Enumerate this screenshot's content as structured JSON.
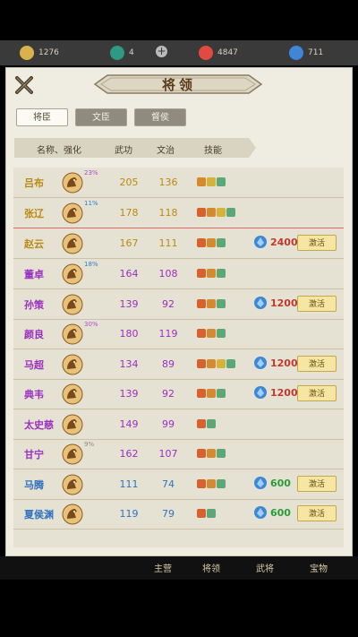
{
  "resources": [
    {
      "icon": "gold-coin-icon",
      "value": "1276",
      "color": "#d9b14d"
    },
    {
      "icon": "jade-icon",
      "value": "4",
      "color": "#2f9a84"
    },
    {
      "icon": "red-crystal-icon",
      "value": "4847",
      "color": "#e04a40"
    },
    {
      "icon": "blue-crystal-icon",
      "value": "711",
      "color": "#3f86d6"
    }
  ],
  "title": "将领",
  "tabs": [
    {
      "label": "将臣",
      "active": true
    },
    {
      "label": "文臣",
      "active": false
    },
    {
      "label": "督侯",
      "active": false
    }
  ],
  "headers": {
    "name": "名称、强化",
    "wugong": "武功",
    "wenzhi": "文治",
    "skills": "技能"
  },
  "rows": [
    {
      "name": "吕布",
      "name_color": "#b88a12",
      "pct": "23%",
      "pct_color": "#b04ad0",
      "wugong": "205",
      "wenzhi": "136",
      "stat_color": "#b88a12",
      "skills": [
        "#d68a2f",
        "#d6b23c",
        "#5aa878"
      ]
    },
    {
      "name": "张辽",
      "name_color": "#b88a12",
      "pct": "11%",
      "pct_color": "#2f80c8",
      "wugong": "178",
      "wenzhi": "118",
      "stat_color": "#b88a12",
      "skills": [
        "#d6622f",
        "#d68a2f",
        "#d6b23c",
        "#5aa878"
      ]
    },
    {
      "name": "赵云",
      "name_color": "#b88a12",
      "pct": "",
      "pct_color": "#b04ad0",
      "wugong": "167",
      "wenzhi": "111",
      "stat_color": "#b88a12",
      "skills": [
        "#d6622f",
        "#d68a2f",
        "#5aa878"
      ],
      "cost": "2400",
      "button": "激活"
    },
    {
      "name": "董卓",
      "name_color": "#9a2fc0",
      "pct": "18%",
      "pct_color": "#2f80c8",
      "wugong": "164",
      "wenzhi": "108",
      "stat_color": "#9a2fc0",
      "skills": [
        "#d6622f",
        "#d68a2f",
        "#5aa878"
      ]
    },
    {
      "name": "孙策",
      "name_color": "#9a2fc0",
      "pct": "",
      "pct_color": "#b04ad0",
      "wugong": "139",
      "wenzhi": "92",
      "stat_color": "#9a2fc0",
      "skills": [
        "#d6622f",
        "#d68a2f",
        "#5aa878"
      ],
      "cost": "1200",
      "button": "激活"
    },
    {
      "name": "颜良",
      "name_color": "#9a2fc0",
      "pct": "30%",
      "pct_color": "#b04ad0",
      "wugong": "180",
      "wenzhi": "119",
      "stat_color": "#9a2fc0",
      "skills": [
        "#d6622f",
        "#d68a2f",
        "#5aa878"
      ]
    },
    {
      "name": "马超",
      "name_color": "#9a2fc0",
      "pct": "",
      "pct_color": "#b04ad0",
      "wugong": "134",
      "wenzhi": "89",
      "stat_color": "#9a2fc0",
      "skills": [
        "#d6622f",
        "#d68a2f",
        "#d6b23c",
        "#5aa878"
      ],
      "cost": "1200",
      "button": "激活"
    },
    {
      "name": "典韦",
      "name_color": "#9a2fc0",
      "pct": "",
      "pct_color": "#b04ad0",
      "wugong": "139",
      "wenzhi": "92",
      "stat_color": "#9a2fc0",
      "skills": [
        "#d6622f",
        "#d68a2f",
        "#5aa878"
      ],
      "cost": "1200",
      "button": "激活"
    },
    {
      "name": "太史慈",
      "name_color": "#9a2fc0",
      "pct": "",
      "pct_color": "#b04ad0",
      "wugong": "149",
      "wenzhi": "99",
      "stat_color": "#9a2fc0",
      "skills": [
        "#d6622f",
        "#5aa878"
      ]
    },
    {
      "name": "甘宁",
      "name_color": "#9a2fc0",
      "pct": "9%",
      "pct_color": "#8a8a8a",
      "wugong": "162",
      "wenzhi": "107",
      "stat_color": "#9a2fc0",
      "skills": [
        "#d6622f",
        "#d68a2f",
        "#5aa878"
      ]
    },
    {
      "name": "马腾",
      "name_color": "#2f72c0",
      "pct": "",
      "pct_color": "#2f80c8",
      "wugong": "111",
      "wenzhi": "74",
      "stat_color": "#2f72c0",
      "skills": [
        "#d6622f",
        "#d68a2f",
        "#5aa878"
      ],
      "cost": "600",
      "cost_color": "#2a9a3a",
      "button": "激活"
    },
    {
      "name": "夏侯渊",
      "name_color": "#2f72c0",
      "pct": "",
      "pct_color": "#2f80c8",
      "wugong": "119",
      "wenzhi": "79",
      "stat_color": "#2f72c0",
      "skills": [
        "#d6622f",
        "#5aa878"
      ],
      "cost": "600",
      "cost_color": "#2a9a3a",
      "button": "激活"
    }
  ],
  "bottom_nav": [
    "主营",
    "将领",
    "武将",
    "宝物"
  ]
}
